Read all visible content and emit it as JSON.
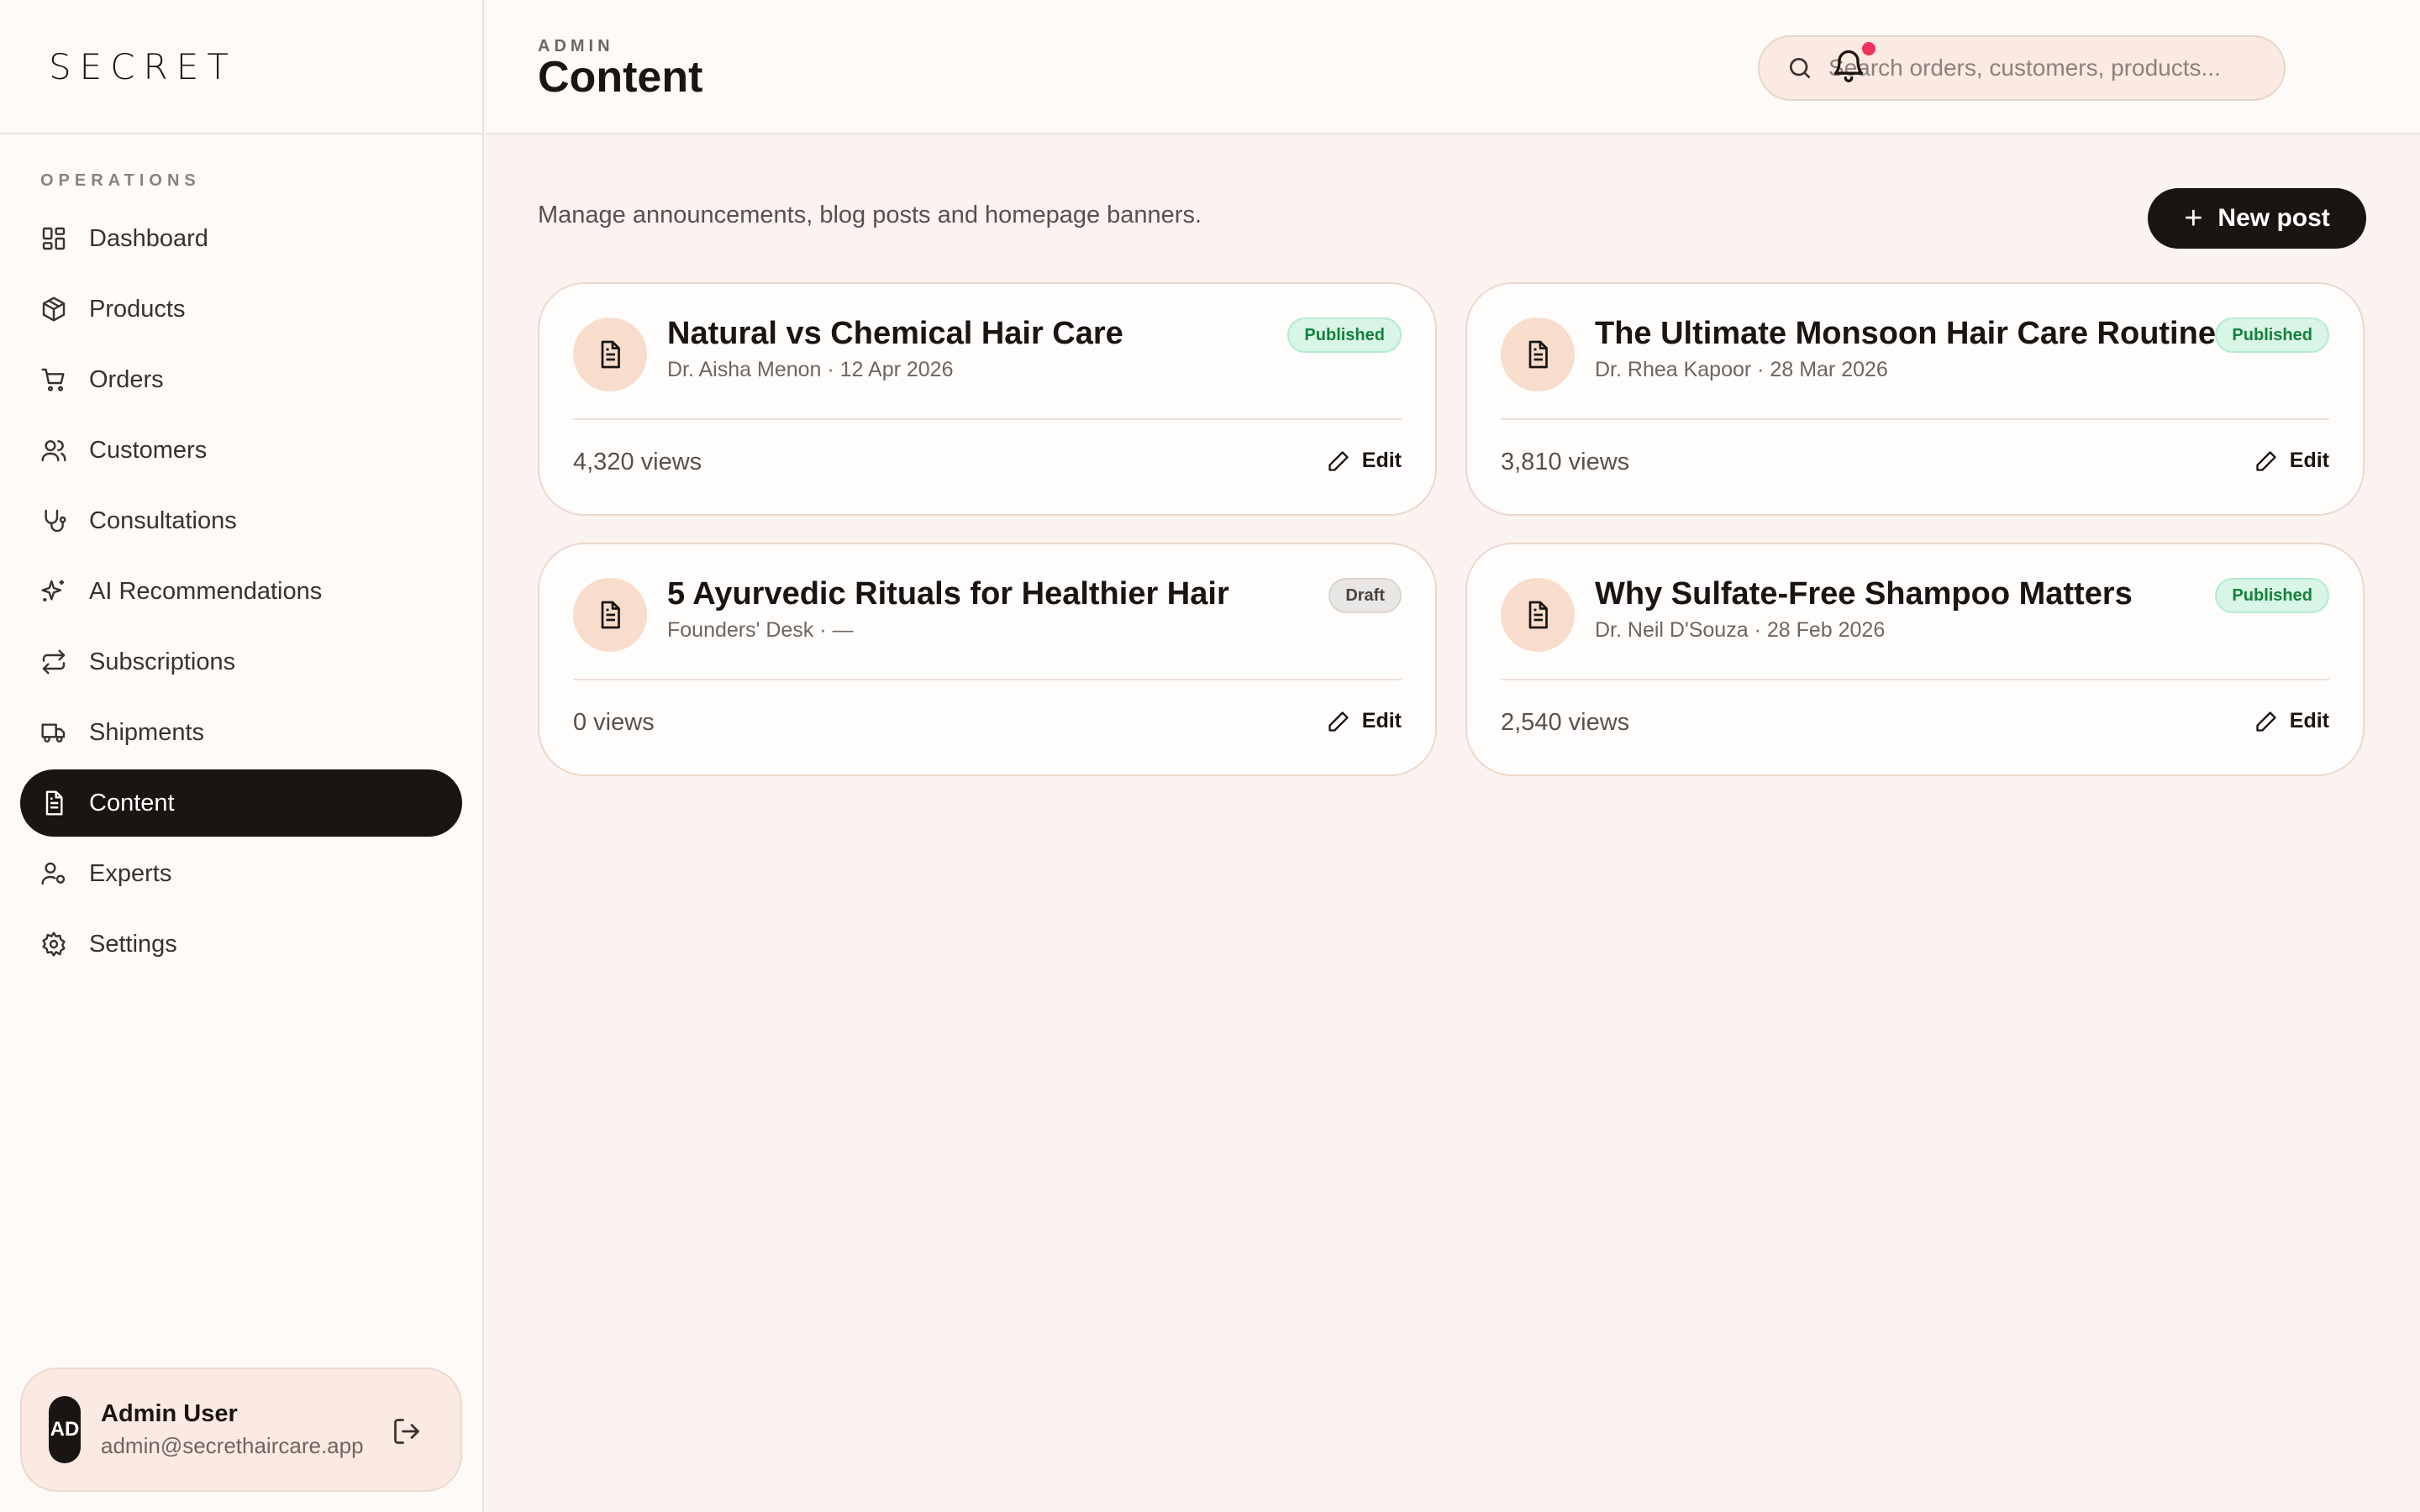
{
  "brand": {
    "logo_text": "SECRET"
  },
  "sidebar": {
    "section_label": "OPERATIONS",
    "items": [
      {
        "label": "Dashboard",
        "icon": "dashboard-icon"
      },
      {
        "label": "Products",
        "icon": "package-icon"
      },
      {
        "label": "Orders",
        "icon": "cart-icon"
      },
      {
        "label": "Customers",
        "icon": "users-icon"
      },
      {
        "label": "Consultations",
        "icon": "stethoscope-icon"
      },
      {
        "label": "AI Recommendations",
        "icon": "sparkles-icon"
      },
      {
        "label": "Subscriptions",
        "icon": "repeat-icon"
      },
      {
        "label": "Shipments",
        "icon": "truck-icon"
      },
      {
        "label": "Content",
        "icon": "document-icon",
        "active": true
      },
      {
        "label": "Experts",
        "icon": "user-cog-icon"
      },
      {
        "label": "Settings",
        "icon": "gear-icon"
      }
    ],
    "user": {
      "initials": "AD",
      "name": "Admin User",
      "email": "admin@secrethaircare.app"
    }
  },
  "header": {
    "eyebrow": "ADMIN",
    "title": "Content",
    "search_placeholder": "Search orders, customers, products...",
    "has_notification": true
  },
  "main": {
    "intro": "Manage announcements, blog posts and homepage banners.",
    "new_post_label": "New post",
    "posts": [
      {
        "title": "Natural vs Chemical Hair Care",
        "meta": "Dr. Aisha Menon · 12 Apr 2026",
        "status": "Published",
        "views": "4,320 views",
        "edit_label": "Edit"
      },
      {
        "title": "The Ultimate Monsoon Hair Care Routine",
        "meta": "Dr. Rhea Kapoor · 28 Mar 2026",
        "status": "Published",
        "views": "3,810 views",
        "edit_label": "Edit"
      },
      {
        "title": "5 Ayurvedic Rituals for Healthier Hair",
        "meta": "Founders' Desk · —",
        "status": "Draft",
        "views": "0 views",
        "edit_label": "Edit"
      },
      {
        "title": "Why Sulfate-Free Shampoo Matters",
        "meta": "Dr. Neil D'Souza · 28 Feb 2026",
        "status": "Published",
        "views": "2,540 views",
        "edit_label": "Edit"
      }
    ]
  },
  "colors": {
    "accent_dark": "#1a1412",
    "published_bg": "#d8f5e5",
    "published_text": "#15803d",
    "notification_dot": "#f0325c"
  }
}
